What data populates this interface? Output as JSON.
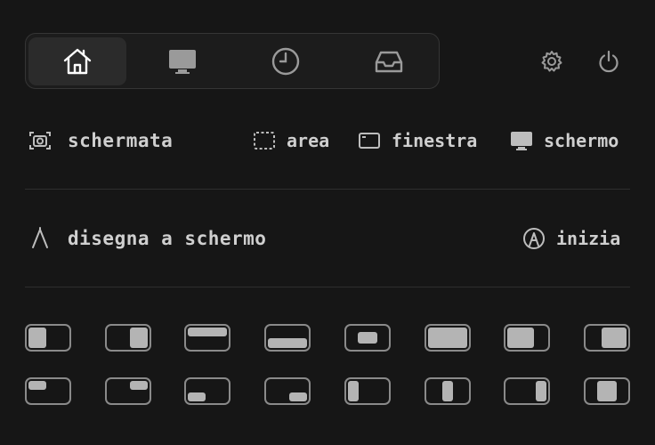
{
  "nav": {
    "tabs": [
      {
        "icon": "home-icon",
        "active": true
      },
      {
        "icon": "monitor-icon",
        "active": false
      },
      {
        "icon": "clock-icon",
        "active": false
      },
      {
        "icon": "inbox-icon",
        "active": false
      }
    ],
    "settings_icon": "gear-icon",
    "power_icon": "power-icon"
  },
  "screenshot": {
    "label": "schermata",
    "options": [
      {
        "icon": "dashed-area-icon",
        "label": "area"
      },
      {
        "icon": "window-icon",
        "label": "finestra"
      },
      {
        "icon": "display-icon",
        "label": "schermo"
      }
    ]
  },
  "draw": {
    "label": "disegna a schermo",
    "action_label": "inizia"
  },
  "layouts": {
    "row1": [
      "left-half",
      "right-half",
      "top-half",
      "bottom-half",
      "center",
      "maximize",
      "left-two-thirds",
      "right-two-thirds"
    ],
    "row2": [
      "top-left-quarter",
      "top-right-quarter",
      "bottom-left-quarter",
      "bottom-right-quarter",
      "left-third",
      "center-third",
      "right-third",
      "center-two-thirds"
    ]
  },
  "colors": {
    "background": "#161616",
    "text": "#cfcfcf",
    "fill": "#b4b4b4",
    "outline": "#8a8a8a"
  }
}
